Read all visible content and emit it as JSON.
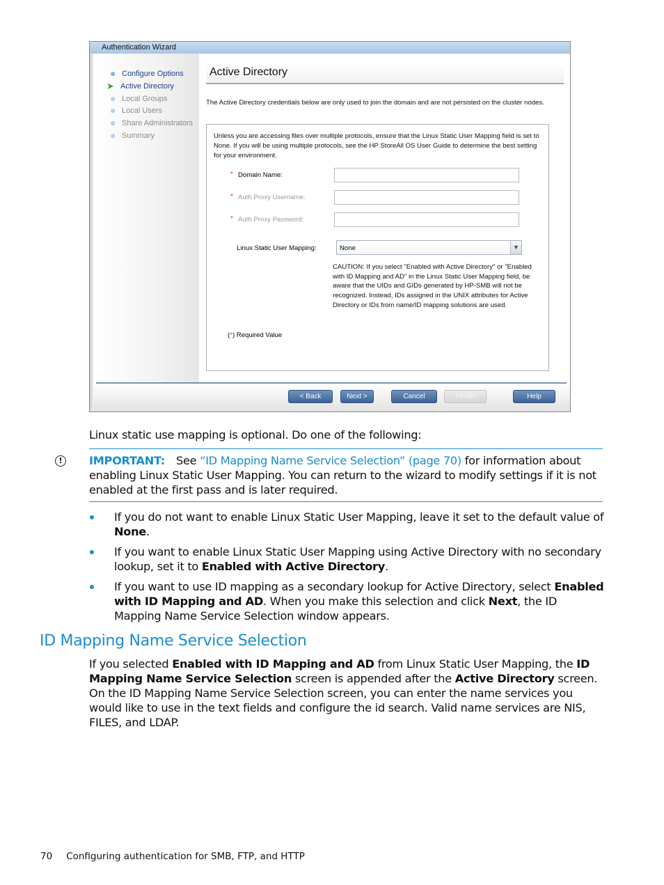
{
  "wizard": {
    "title": "Authentication Wizard",
    "nav": [
      {
        "label": "Configure Options",
        "state": "done"
      },
      {
        "label": "Active Directory",
        "state": "current"
      },
      {
        "label": "Local Groups",
        "state": "pending"
      },
      {
        "label": "Local Users",
        "state": "pending"
      },
      {
        "label": "Share Administrators",
        "state": "pending"
      },
      {
        "label": "Summary",
        "state": "pending"
      }
    ],
    "page_title": "Active Directory",
    "intro": "The Active Directory credentials below are only used to join the domain and are not persisted on the cluster nodes.",
    "note": "Unless you are accessing files over multiple protocols, ensure that the Linux Static User Mapping field is set to None. If you will be using multiple protocols, see the HP StoreAll OS User Guide to determine the best setting for your environment.",
    "fields": {
      "domain_name": {
        "label": "Domain Name:",
        "value": "",
        "required_mark": "*"
      },
      "auth_proxy_username": {
        "label": "Auth Proxy Username:",
        "value": "",
        "required_mark": "*"
      },
      "auth_proxy_password": {
        "label": "Auth Proxy Password:",
        "value": "",
        "required_mark": "*"
      }
    },
    "mapping": {
      "label": "Linux Static User Mapping:",
      "value": "None"
    },
    "caution": "CAUTION: If you select \"Enabled with Active Directory\" or \"Enabled with ID Mapping and AD\" in the Linux Static User Mapping field, be aware that the UIDs and GIDs generated by HP-SMB will not be recognized. Instead, IDs assigned in the UNIX attributes for Active Directory or IDs from name/ID mapping solutions are used.",
    "required": {
      "open": "(",
      "star": "*",
      "close": ") Required Value"
    },
    "buttons": {
      "back": "< Back",
      "next": "Next >",
      "cancel": "Cancel",
      "finish": "Finish",
      "help": "Help"
    }
  },
  "doc": {
    "p1": "Linux static use mapping is optional. Do one of the following:",
    "important": {
      "icon": "!",
      "label": "IMPORTANT:",
      "pre": "See ",
      "link": "“ID Mapping Name Service Selection” (page 70)",
      "post": " for information about enabling Linux Static User Mapping. You can return to the wizard to modify settings if it is not enabled at the first pass and is later required."
    },
    "bullets": [
      {
        "pre": "If you do not want to enable Linux Static User Mapping, leave it set to the default value of ",
        "bold": "None",
        "post": "."
      },
      {
        "pre": "If you want to enable Linux Static User Mapping using Active Directory with no secondary lookup, set it to ",
        "bold": "Enabled with Active Directory",
        "post": "."
      },
      {
        "pre": "If you want to use ID mapping as a secondary lookup for Active Directory, select ",
        "bold": "Enabled with ID Mapping and AD",
        "mid": ". When you make this selection and click ",
        "bold2": "Next",
        "post": ", the ID Mapping Name Service Selection window appears."
      }
    ],
    "heading": "ID Mapping Name Service Selection",
    "p2": {
      "a": "If you selected ",
      "b1": "Enabled with ID Mapping and AD",
      "c": " from Linux Static User Mapping, the ",
      "b2": "ID Mapping Name Service Selection",
      "d": " screen is appended after the ",
      "b3": "Active Directory",
      "e": " screen. On the ID Mapping Name Service Selection screen, you can enter the name services you would like to use in the text fields and configure the id search. Valid name services are NIS, FILES, and LDAP."
    },
    "footer": {
      "page": "70",
      "title": "Configuring authentication for SMB, FTP, and HTTP"
    }
  },
  "colors": {
    "accent": "#1a8dd0",
    "required": "#e03030",
    "nav_link": "#1e3f8a",
    "button": "#3d6496"
  }
}
